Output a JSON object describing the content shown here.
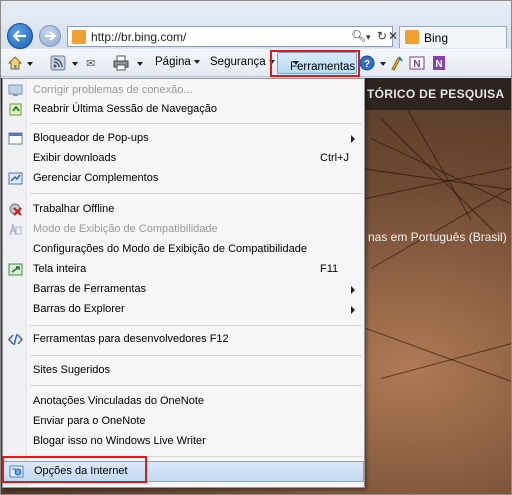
{
  "browser": {
    "url": "http://br.bing.com/",
    "tab_title": "Bing"
  },
  "command_bar": {
    "page_label": "Página",
    "safety_label": "Segurança",
    "tools_label": "Ferramentas"
  },
  "page": {
    "header_text": "TÓRICO DE PESQUISA",
    "language_link": "nas em Português (Brasil)"
  },
  "menu": {
    "items": [
      {
        "label": "Corrigir problemas de conexão...",
        "disabled": true
      },
      {
        "label": "Reabrir Última Sessão de Navegação"
      },
      {
        "label": "Bloqueador de Pop-ups"
      },
      {
        "label": "Exibir downloads",
        "shortcut": "Ctrl+J"
      },
      {
        "label": "Gerenciar Complementos"
      },
      {
        "label": "Trabalhar Offline"
      },
      {
        "label": "Modo de Exibição de Compatibilidade",
        "disabled": true
      },
      {
        "label": "Configurações do Modo de Exibição de Compatibilidade"
      },
      {
        "label": "Tela inteira",
        "shortcut": "F11"
      },
      {
        "label": "Barras de Ferramentas"
      },
      {
        "label": "Barras do Explorer"
      },
      {
        "label": "Ferramentas para desenvolvedores F12"
      },
      {
        "label": "Sites Sugeridos"
      },
      {
        "label": "Anotações Vinculadas do OneNote"
      },
      {
        "label": "Enviar para o OneNote"
      },
      {
        "label": "Blogar isso no Windows Live Writer"
      },
      {
        "label": "Opções da Internet"
      }
    ]
  },
  "colors": {
    "highlight_box": "#e01818",
    "menu_bg": "#f5f6f7",
    "page_header": "#2d2420"
  },
  "icons": [
    "back-arrow-icon",
    "forward-arrow-icon",
    "search-icon",
    "refresh-icon",
    "stop-icon",
    "home-icon",
    "rss-feed-icon",
    "print-icon",
    "help-icon",
    "onenote-icon",
    "live-writer-icon"
  ]
}
